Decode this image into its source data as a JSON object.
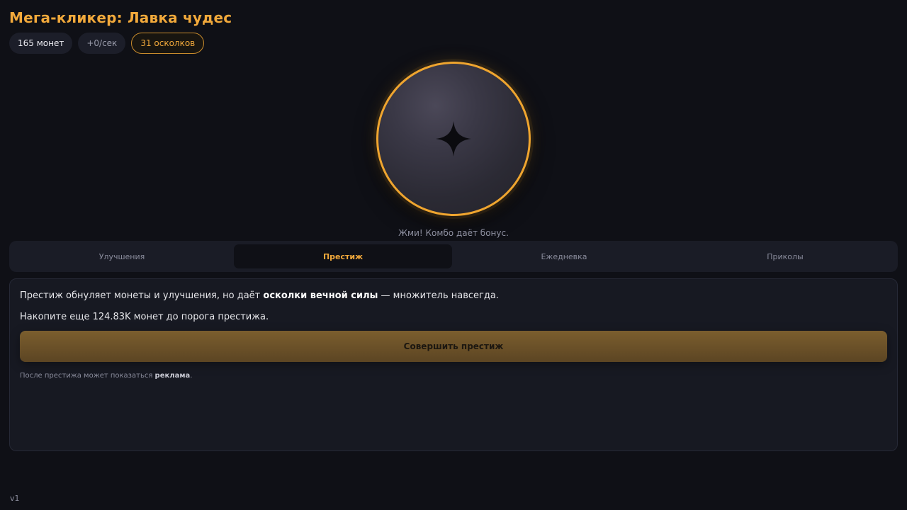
{
  "app": {
    "title": "Мега-кликер: Лавка чудес",
    "version": "v1"
  },
  "stats": {
    "coins": "165 монет",
    "rate": "+0/сек",
    "shards": "31 осколков"
  },
  "clicker": {
    "icon": "four-point-star-icon",
    "hint": "Жми! Комбо даёт бонус."
  },
  "tabs": [
    {
      "label": "Улучшения",
      "active": false
    },
    {
      "label": "Престиж",
      "active": true
    },
    {
      "label": "Ежедневка",
      "active": false
    },
    {
      "label": "Приколы",
      "active": false
    }
  ],
  "prestige": {
    "desc_before": "Престиж обнуляет монеты и улучшения, но даёт ",
    "desc_bold": "осколки вечной силы",
    "desc_after": " — множитель навсегда.",
    "remaining": "Накопите еще 124.83K монет до порога престижа.",
    "button_label": "Совершить престиж",
    "note_before": "После престижа может показаться ",
    "note_bold": "реклама",
    "note_after": "."
  },
  "colors": {
    "accent": "#f2a93b",
    "background": "#0f1016",
    "panel": "#171922",
    "coin_border": "#efa52f"
  }
}
